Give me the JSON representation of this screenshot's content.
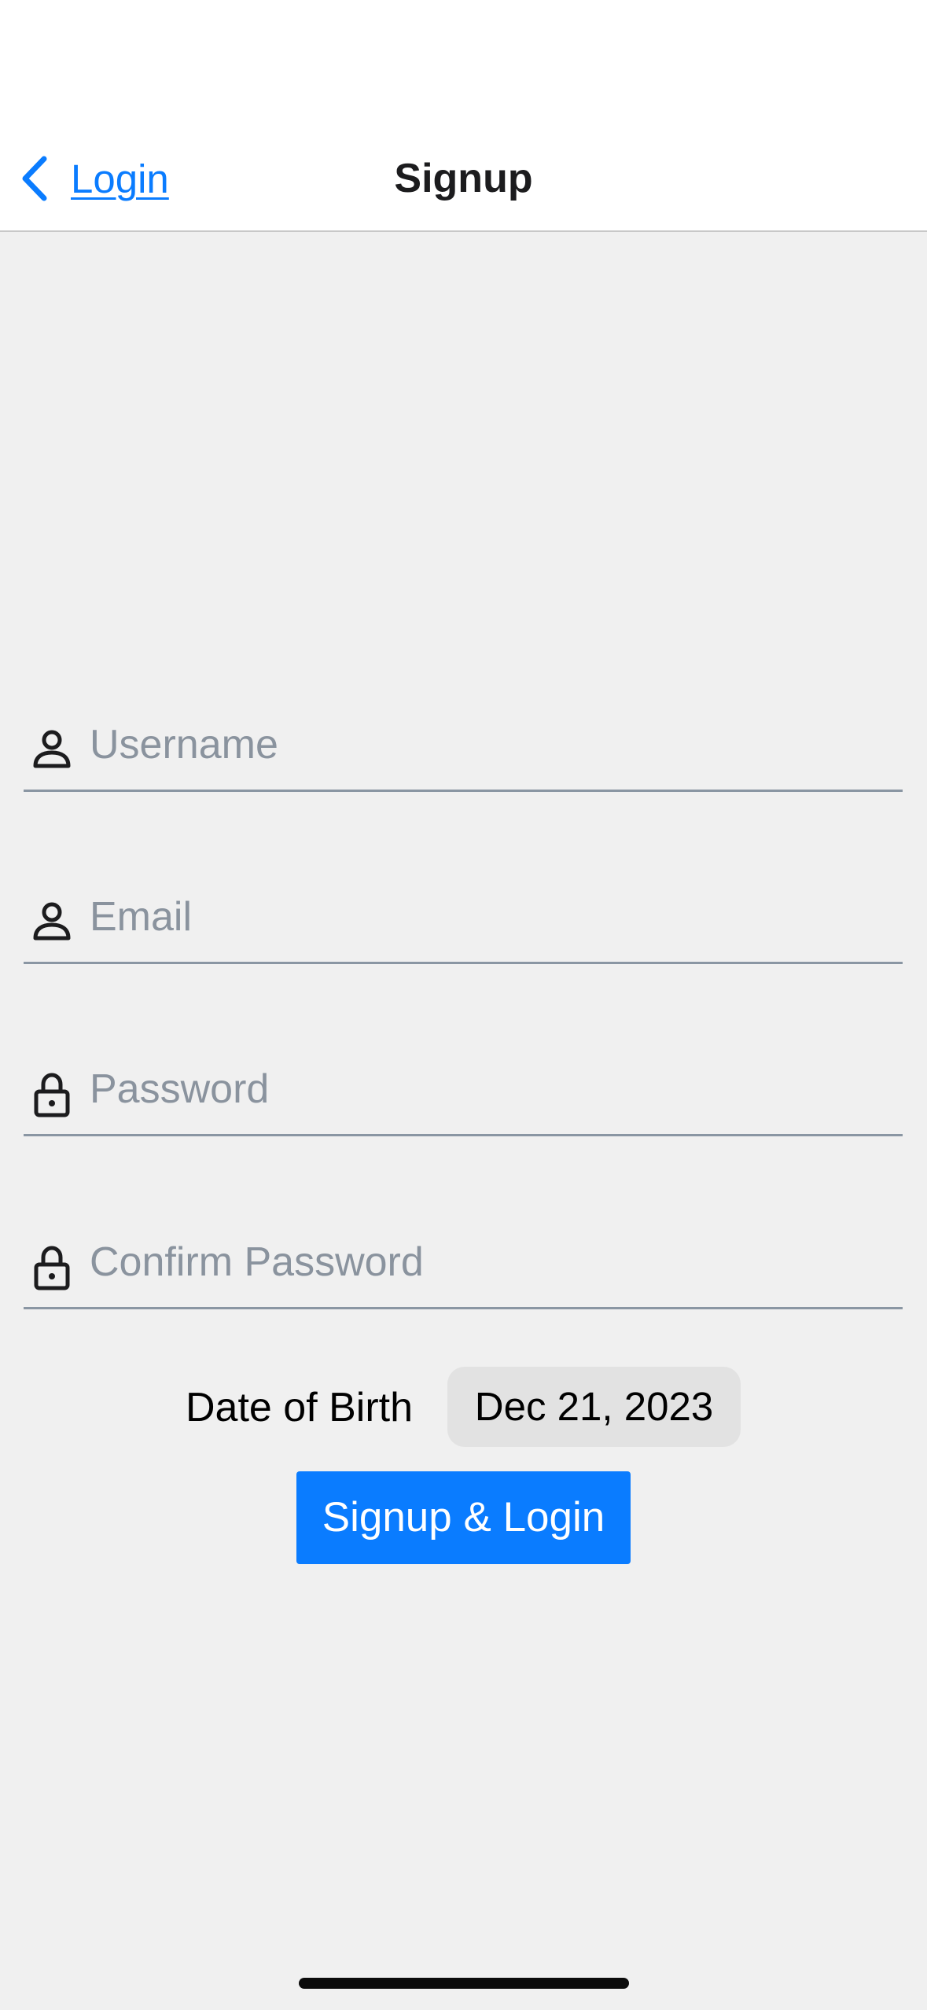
{
  "nav": {
    "back_label": "Login",
    "title": "Signup"
  },
  "form": {
    "fields": [
      {
        "placeholder": "Username",
        "value": "",
        "icon": "person-icon"
      },
      {
        "placeholder": "Email",
        "value": "",
        "icon": "person-icon"
      },
      {
        "placeholder": "Password",
        "value": "",
        "icon": "lock-icon"
      },
      {
        "placeholder": "Confirm Password",
        "value": "",
        "icon": "lock-icon"
      }
    ],
    "dob_label": "Date of Birth",
    "dob_value": "Dec 21, 2023",
    "submit_label": "Signup & Login"
  },
  "colors": {
    "accent": "#0a7cff",
    "background": "#f0f0f0",
    "placeholder": "#8a939e",
    "field_underline": "#8a96a3"
  }
}
